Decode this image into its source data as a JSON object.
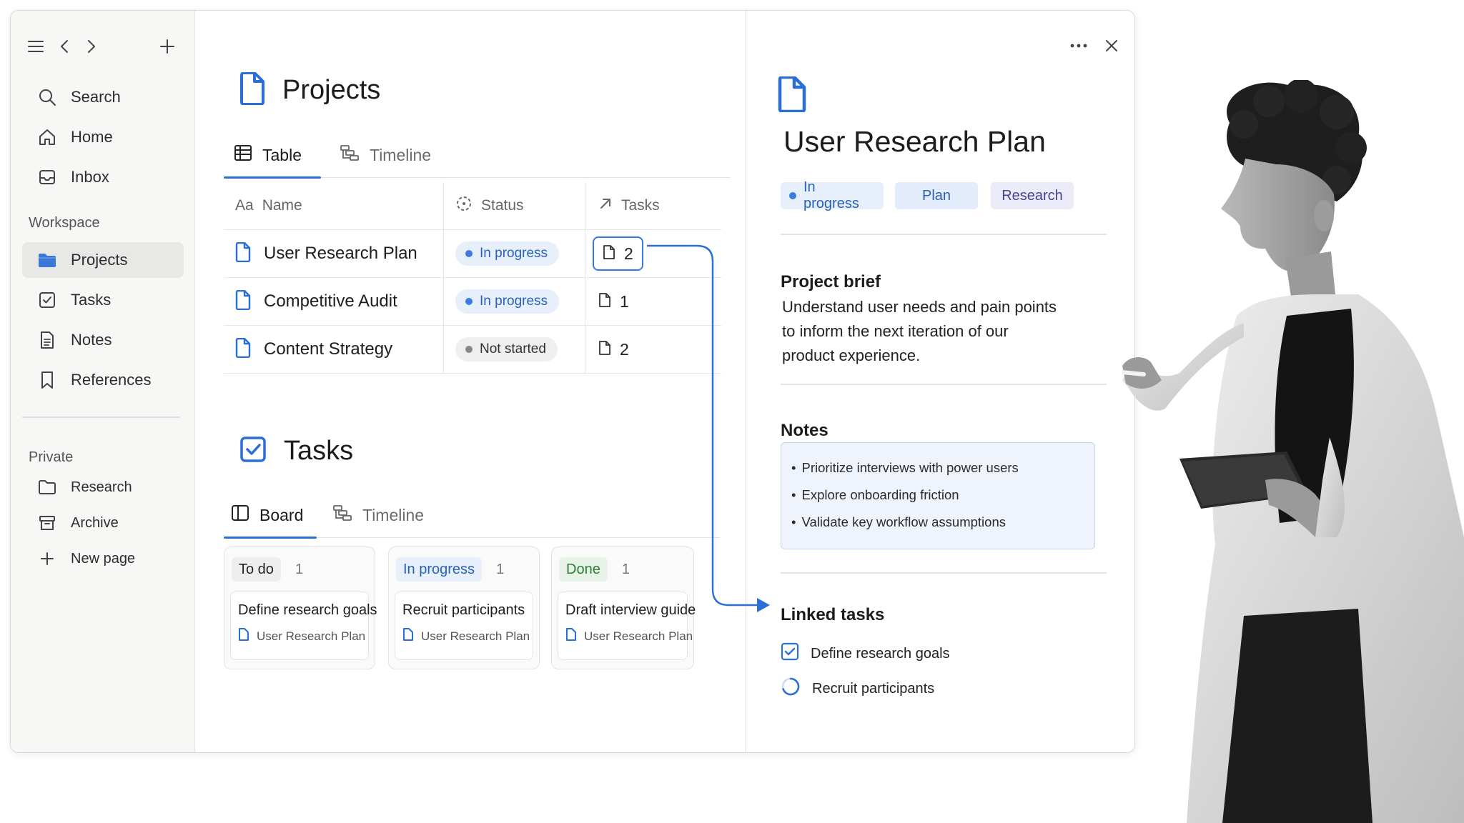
{
  "sidebar": {
    "nav": [
      {
        "label": "Search",
        "icon": "search-icon"
      },
      {
        "label": "Home",
        "icon": "home-icon"
      },
      {
        "label": "Inbox",
        "icon": "inbox-icon"
      }
    ],
    "workspace_label": "Workspace",
    "workspace_items": [
      {
        "label": "Projects",
        "icon": "folder-icon",
        "active": true
      },
      {
        "label": "Tasks",
        "icon": "checkbox-icon"
      },
      {
        "label": "Notes",
        "icon": "note-icon"
      },
      {
        "label": "References",
        "icon": "bookmark-icon"
      }
    ],
    "private_label": "Private",
    "private_items": [
      {
        "label": "Research",
        "icon": "folder-outline-icon"
      },
      {
        "label": "Archive",
        "icon": "archive-icon"
      },
      {
        "label": "New page",
        "icon": "plus-icon"
      }
    ]
  },
  "projects": {
    "title": "Projects",
    "tabs": [
      "Table",
      "Timeline"
    ],
    "columns": {
      "name_prefix": "Aa",
      "name": "Name",
      "status": "Status",
      "tasks": "Tasks"
    },
    "rows": [
      {
        "name": "User Research Plan",
        "status": "In progress",
        "tasks": "2"
      },
      {
        "name": "Competitive Audit",
        "status": "In progress",
        "tasks": "1"
      },
      {
        "name": "Content Strategy",
        "status": "Not started",
        "tasks": "2"
      }
    ]
  },
  "tasks": {
    "title": "Tasks",
    "tabs": [
      "Board",
      "Timeline"
    ],
    "columns": [
      {
        "label": "To do",
        "count": "1",
        "card": {
          "title": "Define research goals",
          "ref": "User Research Plan"
        }
      },
      {
        "label": "In progress",
        "count": "1",
        "card": {
          "title": "Recruit participants",
          "ref": "User Research Plan"
        }
      },
      {
        "label": "Done",
        "count": "1",
        "card": {
          "title": "Draft interview guide",
          "ref": "User Research Plan"
        }
      }
    ]
  },
  "detail": {
    "title": "User Research Plan",
    "tags": [
      "In progress",
      "Plan",
      "Research"
    ],
    "brief_heading": "Project brief",
    "brief_lines": [
      "Understand user needs and pain points",
      "to inform the next iteration of our",
      "product experience."
    ],
    "notes_heading": "Notes",
    "notes": [
      "Prioritize interviews with power users",
      "Explore onboarding friction",
      "Validate key workflow assumptions"
    ],
    "linked_heading": "Linked tasks",
    "linked": [
      {
        "label": "Define research goals",
        "state": "done"
      },
      {
        "label": "Recruit participants",
        "state": "in-progress"
      }
    ]
  },
  "colors": {
    "accent": "#2a6fd6",
    "in_progress": "#3a7be0",
    "done": "#2e7d32"
  }
}
